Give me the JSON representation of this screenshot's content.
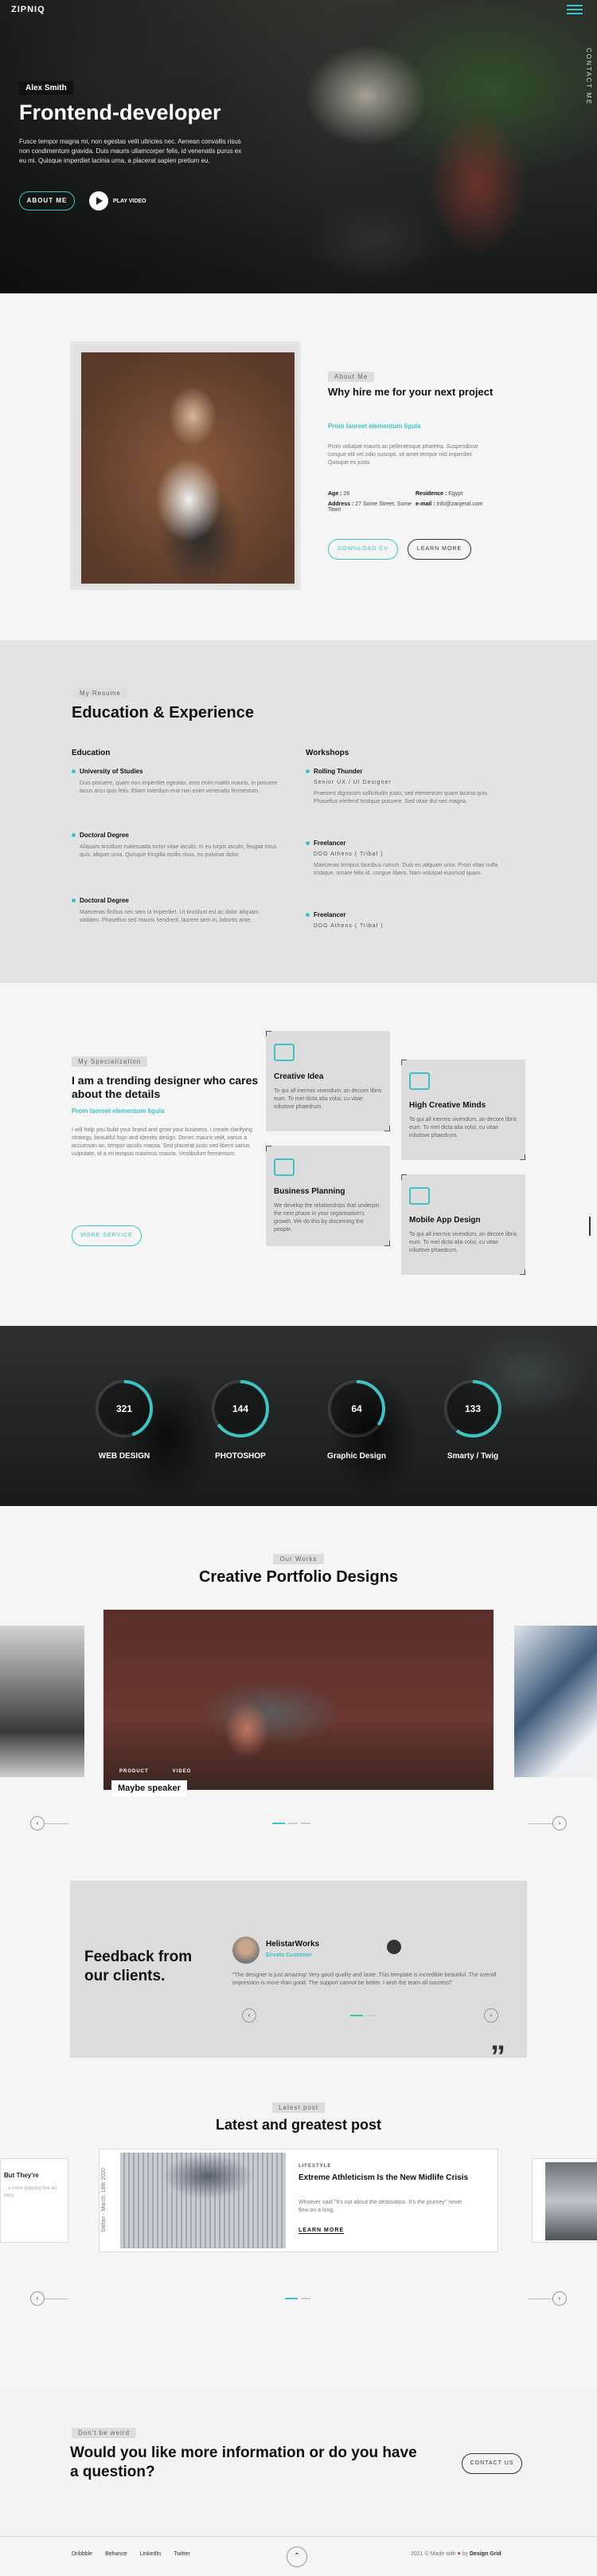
{
  "colors": {
    "accent": "#3ec3c3",
    "dark": "#111111",
    "panel": "#dcdcdc"
  },
  "header": {
    "logo": "ZIPNIQ",
    "menu_icon": "menu-icon",
    "side_text": "CONTACT ME"
  },
  "hero": {
    "name_tag": "Alex Smith",
    "title": "Frontend-developer",
    "description": "Fusce tempor magna mi, non egestas velit ultricies nec. Aenean convallis risus non condimentum gravida. Duis mauris ullamcorper felis, id venenatis purus ex eu mi. Quisque imperdiet lacinia urna, a placerat sapien pretium eu.",
    "about_button": "ABOUT ME",
    "play_label": "PLAY VIDEO"
  },
  "about": {
    "tag": "About Me",
    "title": "Why hire me for your next project",
    "subtitle": "Proin laoreet elementum ligula",
    "text": "Proin volutpat mauris ac pellentesque pharetra. Suspendisse congue elit vel odio suscipit, sit amet tempor nisl imperdiet. Quisque ex justo.",
    "age_label": "Age :",
    "age_value": "26",
    "residence_label": "Residence :",
    "residence_value": "Egypt",
    "address_label": "Address :",
    "address_value": "27 Some Street, Some Town",
    "email_label": "e-mail :",
    "email_value": "info@zanjeral.com",
    "download_button": "DOWNLOAD CV",
    "learn_button": "LEARN MORE"
  },
  "resume": {
    "tag": "My Resume",
    "title": "Education & Experience",
    "education_heading": "Education",
    "workshops_heading": "Workshops",
    "education": [
      {
        "title": "University of Studies",
        "subtitle": "",
        "text": "Duis posuere, quam non imperdiet egestas, eros enim mattis mauris, in posuere lacus arcu quis felis. Etiam interdum erat non enim venenatis fermentum."
      },
      {
        "title": "Doctoral Degree",
        "subtitle": "",
        "text": "Aliquam tincidunt malesuada tortor vitae iaculis. In eu turpis iaculis, feugiat risus quis, aliquet urna. Quisque fringilla mollis risus, eu pulvinar dolor."
      },
      {
        "title": "Doctoral Degree",
        "subtitle": "",
        "text": "Maecenas finibus nec sem ut imperdiet. Ut tincidunt est ac dolor aliquam sodales. Phasellus sed mauris hendrerit, laoreet sem in, lobortis ante."
      }
    ],
    "workshops": [
      {
        "title": "Rolling Thunder",
        "subtitle": "Senior UX / UI Designer",
        "text": "Praesent dignissim sollicitudin justo, sed elementum quam lacinia quis. Phasellus eleifend tristique posuere. Sed vitae dui nec magna."
      },
      {
        "title": "Freelancer",
        "subtitle": "DDG Athens ( Tribal )",
        "text": "Maecenas tempus faucibus rutrum. Duis eu aliquam urna. Proin vitae nulla tristique, ornare felis id, congue libero. Nam volutpat euismod quam."
      },
      {
        "title": "Freelancer",
        "subtitle": "DDG Athens ( Tribal )",
        "text": ""
      }
    ]
  },
  "services": {
    "tag": "My Specialization",
    "title": "I am a trending designer who cares about the details",
    "subtitle": "Proin laoreet elementum ligula",
    "text": "I will help you build your brand and grow your business. I create clarifying strategy, beautiful logo and identity design. Donec mauris velit, varius a accumsan ac, tempor iaculis massa. Sed placerat justo sed libero varius vulputate, id a mi tempus maximus mauris. Vestibulum fermentum.",
    "button": "MORE SERVICE",
    "cards": [
      {
        "title": "Creative Idea",
        "text": "To qui all inermis vivendum, an decore libris eum. To mel dicta alia volui, cu vitae inliutove phaedrum."
      },
      {
        "title": "High Creative Minds",
        "text": "To qui all inermis vivendum, an decore libris eum. To mel dicta alia volui, cu vitae inliutove phaedrum."
      },
      {
        "title": "Business Planning",
        "text": "We develop the relationships that underpin the next phase in your organisation's growth. We do this by discerning the people."
      },
      {
        "title": "Mobile App Design",
        "text": "To qui all inermis vivendum, an decore libris eum. To mel dicta alia volui, cu vitae inliutove phaedrum."
      }
    ]
  },
  "skills": [
    {
      "value": "321",
      "label": "WEB DESIGN",
      "fraction": 0.45
    },
    {
      "value": "144",
      "label": "PHOTOSHOP",
      "fraction": 0.65
    },
    {
      "value": "64",
      "label": "Graphic Design",
      "fraction": 0.35
    },
    {
      "value": "133",
      "label": "Smarty / Twig",
      "fraction": 0.6
    }
  ],
  "portfolio": {
    "tag": "Our Works",
    "title": "Creative Portfolio Designs",
    "categories": [
      "PRODUCT",
      "VIDEO"
    ],
    "caption": "Maybe speaker"
  },
  "feedback": {
    "title": "Feedback from our clients.",
    "name": "HelistarWorks",
    "role": "Envato Customer",
    "quote": "\"The designer is just amazing! Very good quality and taste. This template is incredible beautiful. The overall impression is more than good. The support cannot be better. I wish the team all success!\""
  },
  "blog": {
    "tag": "Latest post",
    "title": "Latest and greatest post",
    "date": "Stéfan - March, 18th 2020",
    "category": "LIFESTYLE",
    "post_title": "Extreme Athleticism Is the New Midlife Crisis",
    "text": "Whoever said \"It's not about the destination. It's the journey\" never flew on a long.",
    "more": "LEARN MORE",
    "left_title": "But They're",
    "left_text": "...a more gripping line an easy"
  },
  "contact": {
    "tag": "Don't be weird",
    "title": "Would you like more information or do you have a question?",
    "button": "CONTACT US"
  },
  "footer": {
    "links": [
      "Dribbble",
      "Behance",
      "LinkedIn",
      "Twitter"
    ],
    "copy_prefix": "2021 © Made with",
    "copy_by": "by",
    "brand": "Design Grid"
  }
}
